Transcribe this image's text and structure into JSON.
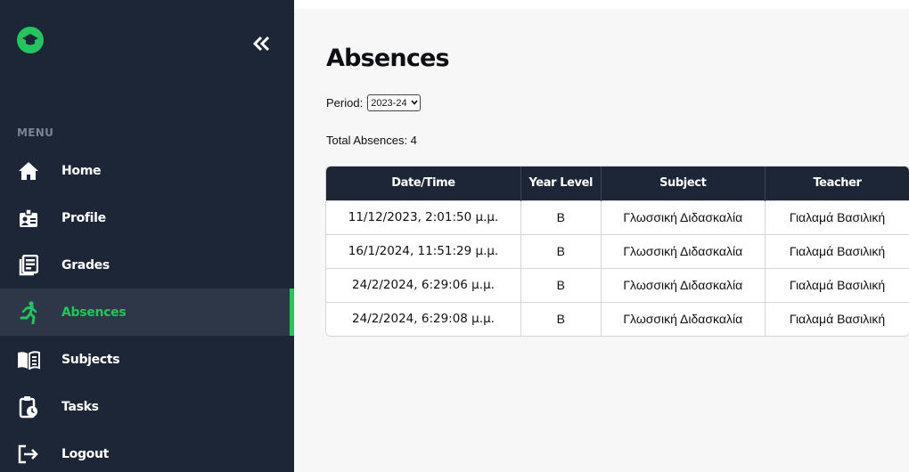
{
  "sidebar": {
    "menu_heading": "MENU",
    "items": [
      {
        "label": "Home",
        "icon": "home-icon"
      },
      {
        "label": "Profile",
        "icon": "profile-id-icon"
      },
      {
        "label": "Grades",
        "icon": "grades-document-icon"
      },
      {
        "label": "Absences",
        "icon": "running-person-icon",
        "active": true
      },
      {
        "label": "Subjects",
        "icon": "open-book-icon"
      },
      {
        "label": "Tasks",
        "icon": "clipboard-clock-icon"
      },
      {
        "label": "Logout",
        "icon": "logout-icon"
      }
    ]
  },
  "colors": {
    "sidebar_bg": "#1d2636",
    "accent": "#22c55e",
    "header_bg": "#1d2636"
  },
  "main": {
    "title": "Absences",
    "period_label": "Period:",
    "period_value": "2023-24",
    "total_absences": "Total Absences: 4"
  },
  "table": {
    "headers": [
      "Date/Time",
      "Year Level",
      "Subject",
      "Teacher"
    ],
    "rows": [
      [
        "11/12/2023, 2:01:50 μ.μ.",
        "B",
        "Γλωσσική Διδασκαλία",
        "Γιαλαμά Βασιλική"
      ],
      [
        "16/1/2024, 11:51:29 μ.μ.",
        "B",
        "Γλωσσική Διδασκαλία",
        "Γιαλαμά Βασιλική"
      ],
      [
        "24/2/2024, 6:29:06 μ.μ.",
        "B",
        "Γλωσσική Διδασκαλία",
        "Γιαλαμά Βασιλική"
      ],
      [
        "24/2/2024, 6:29:08 μ.μ.",
        "B",
        "Γλωσσική Διδασκαλία",
        "Γιαλαμά Βασιλική"
      ]
    ]
  }
}
